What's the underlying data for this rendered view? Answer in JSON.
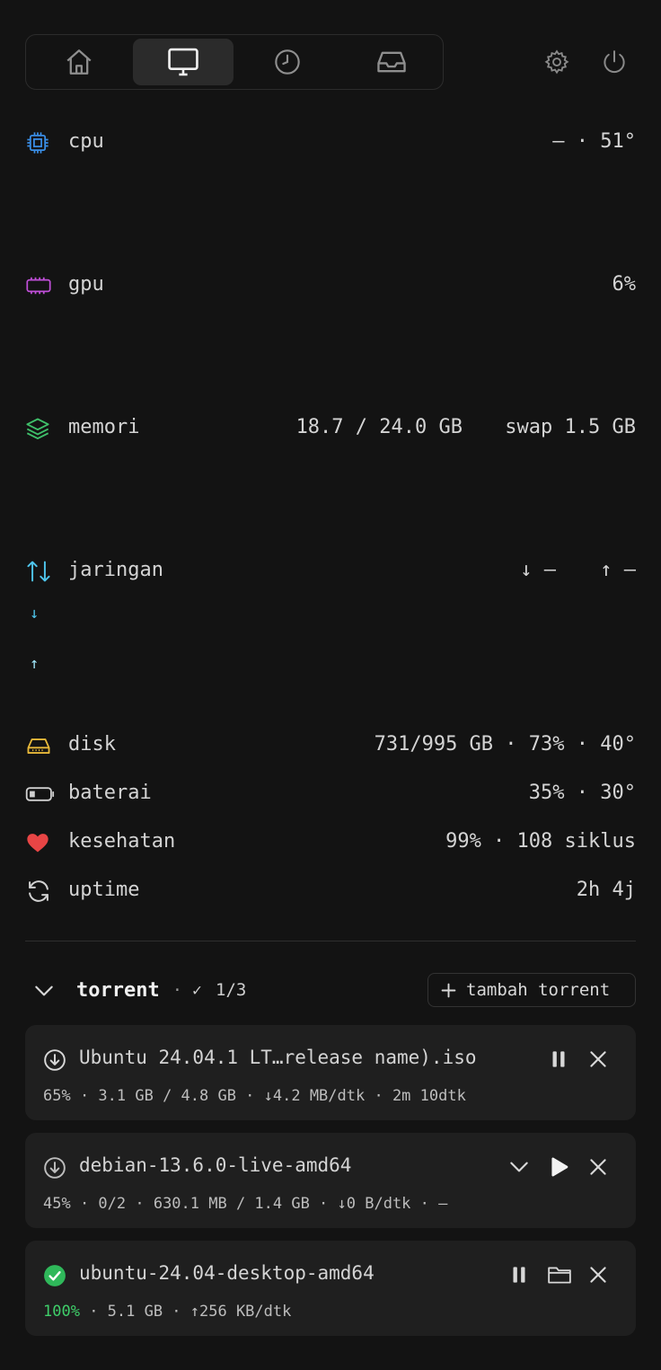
{
  "nav": {
    "tabs": [
      {
        "icon": "home-icon",
        "active": false
      },
      {
        "icon": "monitor-icon",
        "active": true
      },
      {
        "icon": "clock-icon",
        "active": false
      },
      {
        "icon": "inbox-icon",
        "active": false
      }
    ],
    "settings_icon": "gear-icon",
    "power_icon": "power-icon"
  },
  "stats": {
    "cpu": {
      "label": "cpu",
      "value": "— · 51°",
      "icon": "cpu-icon",
      "color": "#3a8ee6"
    },
    "gpu": {
      "label": "gpu",
      "value": "6%",
      "icon": "gpu-icon",
      "color": "#c04fd8"
    },
    "memory": {
      "label": "memori",
      "value": "18.7 / 24.0 GB",
      "swap": "swap 1.5 GB",
      "icon": "layers-icon",
      "color": "#3fbf6a"
    },
    "network": {
      "label": "jaringan",
      "down": "↓ —",
      "up": "↑ —",
      "down_arrow": "↓",
      "up_arrow": "↑",
      "icon": "arrows-up-down-icon",
      "down_color": "#4ec3ea",
      "up_color": "#9fe3f6"
    },
    "disk": {
      "label": "disk",
      "value": "731/995 GB · 73% · 40°",
      "icon": "hard-drive-icon",
      "color": "#e8b93a"
    },
    "battery": {
      "label": "baterai",
      "value": "35% · 30°",
      "icon": "battery-icon",
      "color": "#d0d0d0"
    },
    "health": {
      "label": "kesehatan",
      "value": "99% · 108 siklus",
      "icon": "heart-icon",
      "color": "#e84545"
    },
    "uptime": {
      "label": "uptime",
      "value": "2h 4j",
      "icon": "refresh-icon",
      "color": "#d0d0d0"
    }
  },
  "torrent": {
    "title": "torrent",
    "sep": "·",
    "check": "✓",
    "count": "1/3",
    "add_label": "tambah torrent",
    "add_icon": "plus-icon",
    "collapse_icon": "chevron-down-icon",
    "items": [
      {
        "name": "Ubuntu 24.04.1 LT…release name).iso",
        "status_icon": "download-circle-icon",
        "percent": "65%",
        "meta": " · 3.1 GB / 4.8 GB · ↓4.2 MB/dtk · 2m 10dtk",
        "progress": 0.65,
        "actions": [
          "pause-icon",
          "close-icon"
        ]
      },
      {
        "name": "debian-13.6.0-live-amd64",
        "status_icon": "download-circle-icon",
        "percent": "45%",
        "meta": " · 0/2 · 630.1 MB / 1.4 GB · ↓0 B/dtk · —",
        "progress": 0.45,
        "actions": [
          "chevron-down-icon",
          "play-icon",
          "close-icon"
        ]
      },
      {
        "name": "ubuntu-24.04-desktop-amd64",
        "status_icon": "check-circle-icon",
        "percent": "100%",
        "meta": " · 5.1 GB · ↑256 KB/dtk",
        "progress": 1.0,
        "percent_color": "#3fcf6a",
        "actions": [
          "pause-icon",
          "folder-icon",
          "close-icon"
        ]
      }
    ]
  }
}
